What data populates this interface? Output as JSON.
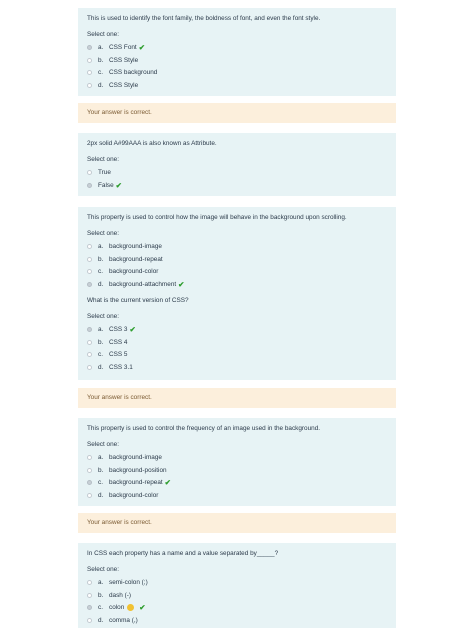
{
  "select_label": "Select one:",
  "feedback_text": "Your answer is correct.",
  "questions": [
    {
      "text": "This is used to identify the font family, the boldness of font, and even the font style.",
      "options": [
        {
          "letter": "a.",
          "label": "CSS Font"
        },
        {
          "letter": "b.",
          "label": "CSS Style"
        },
        {
          "letter": "c.",
          "label": "CSS background"
        },
        {
          "letter": "d.",
          "label": "CSS Style"
        }
      ]
    },
    {
      "text": "2px solid A#99AAA is also known as Attribute.",
      "options": [
        {
          "label": "True"
        },
        {
          "label": "False"
        }
      ]
    },
    {
      "text": "This property is used to control how the image will behave in the background upon scrolling.",
      "options": [
        {
          "letter": "a.",
          "label": "background-image"
        },
        {
          "letter": "b.",
          "label": "background-repeat"
        },
        {
          "letter": "c.",
          "label": "background-color"
        },
        {
          "letter": "d.",
          "label": "background-attachment"
        }
      ]
    },
    {
      "text": "What is the current version of CSS?",
      "options": [
        {
          "letter": "a.",
          "label": "CSS 3"
        },
        {
          "letter": "b.",
          "label": "CSS 4"
        },
        {
          "letter": "c.",
          "label": "CSS 5"
        },
        {
          "letter": "d.",
          "label": "CSS 3.1"
        }
      ]
    },
    {
      "text": "This property is used to control the frequency of an image used in the background.",
      "options": [
        {
          "letter": "a.",
          "label": "background-image"
        },
        {
          "letter": "b.",
          "label": "background-position"
        },
        {
          "letter": "c.",
          "label": "background-repeat"
        },
        {
          "letter": "d.",
          "label": "background-color"
        }
      ]
    },
    {
      "text": "In CSS each property has a name and a value separated by_____?",
      "options": [
        {
          "letter": "a.",
          "label": "semi-colon (;)"
        },
        {
          "letter": "b.",
          "label": "dash (-)"
        },
        {
          "letter": "c.",
          "label": "colon"
        },
        {
          "letter": "d.",
          "label": "comma (,)"
        }
      ]
    }
  ]
}
